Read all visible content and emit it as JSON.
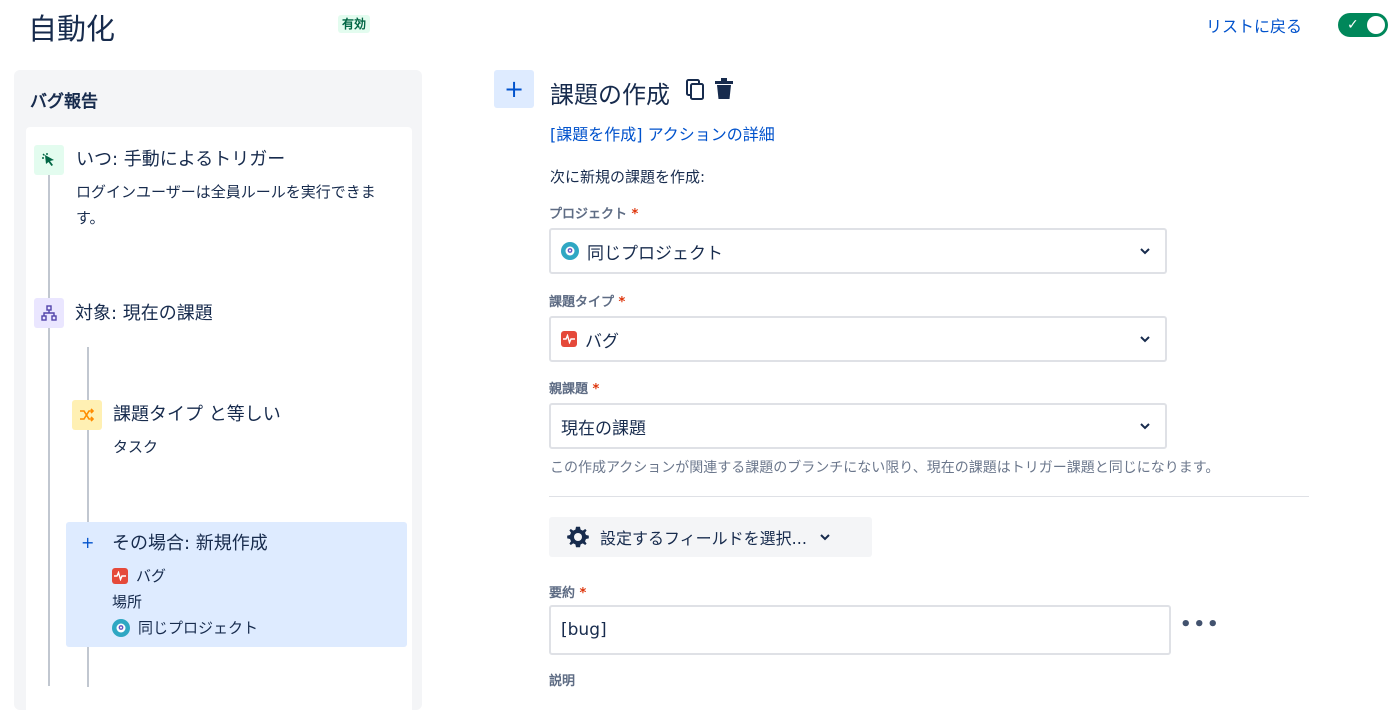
{
  "header": {
    "title": "自動化",
    "status_badge": "有効",
    "back_link": "リストに戻る",
    "enabled": true
  },
  "rule": {
    "name": "バグ報告",
    "steps": [
      {
        "title": "いつ: 手動によるトリガー",
        "desc": "ログインユーザーは全員ルールを実行できます。",
        "icon": "cursor-click-icon"
      },
      {
        "title": "対象: 現在の課題",
        "icon": "hierarchy-icon"
      },
      {
        "title": "課題タイプ と等しい",
        "desc": "タスク",
        "icon": "shuffle-icon"
      },
      {
        "title": "その場合: 新規作成",
        "line1": "バグ",
        "line2": "場所",
        "line3": "同じプロジェクト",
        "icon": "plus-icon"
      }
    ]
  },
  "action": {
    "add_label": "+",
    "title": "課題の作成",
    "details_link": "[課題を作成] アクションの詳細",
    "intro": "次に新規の課題を作成:",
    "fields": {
      "project": {
        "label": "プロジェクト",
        "required": "*",
        "value": "同じプロジェクト"
      },
      "issue_type": {
        "label": "課題タイプ",
        "required": "*",
        "value": "バグ"
      },
      "parent": {
        "label": "親課題",
        "required": "*",
        "value": "現在の課題"
      }
    },
    "helper": "この作成アクションが関連する課題のブランチにない限り、現在の課題はトリガー課題と同じになります。",
    "fields_button": "設定するフィールドを選択...",
    "summary": {
      "label": "要約",
      "required": "*",
      "value": "[bug]"
    },
    "description_label": "説明",
    "more": "•••"
  },
  "colors": {
    "accent": "#0052cc",
    "toggle_on": "#00875a",
    "bug": "#e5493a",
    "selected_bg": "#deebff"
  }
}
